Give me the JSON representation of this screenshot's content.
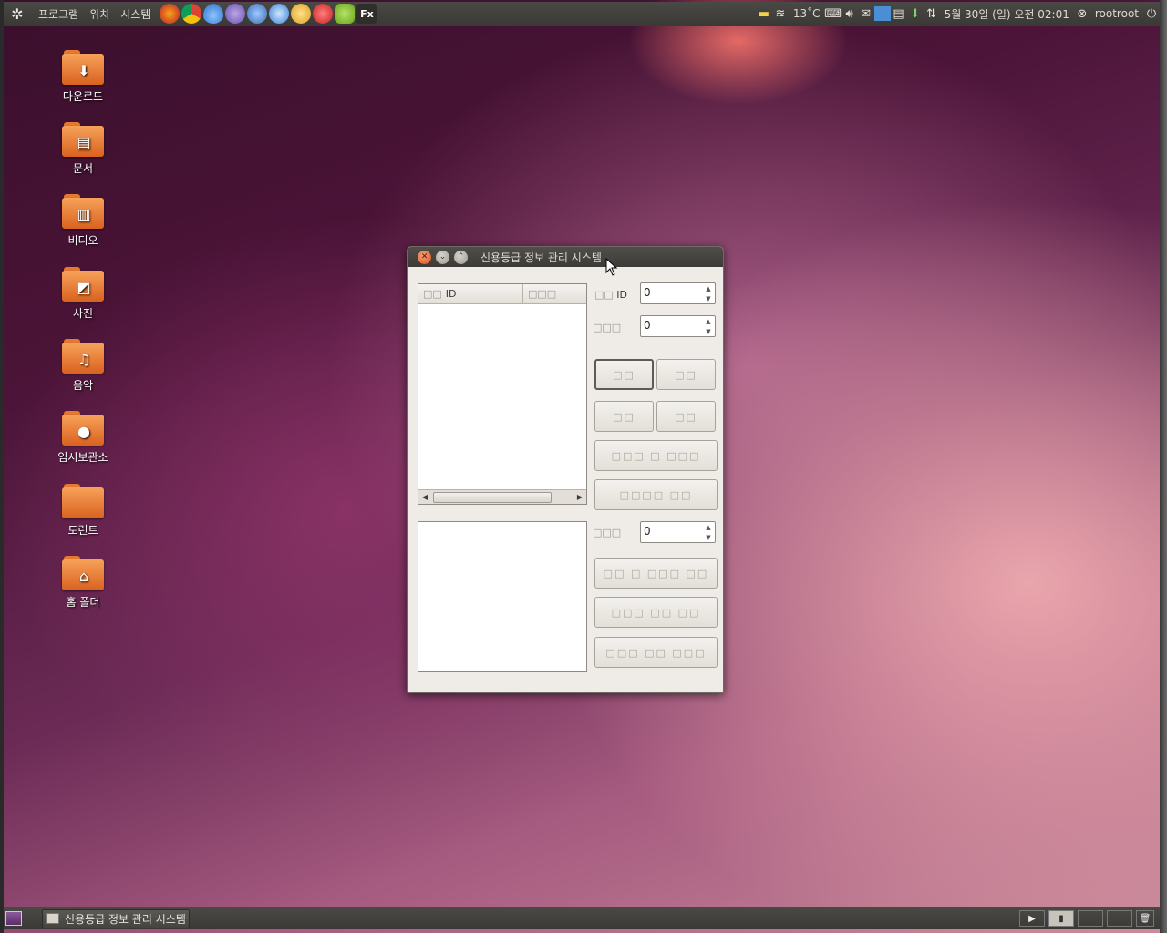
{
  "top_panel": {
    "menus": [
      "프로그램",
      "위치",
      "시스템"
    ],
    "launchers": [
      {
        "icon": "firefox-icon",
        "label": ""
      },
      {
        "icon": "chrome-icon",
        "label": ""
      },
      {
        "icon": "water-drop-icon",
        "label": ""
      },
      {
        "icon": "pidgin-icon",
        "label": ""
      },
      {
        "icon": "thunderbird-icon",
        "label": ""
      },
      {
        "icon": "blue-app-icon",
        "label": ""
      },
      {
        "icon": "cat-app-icon",
        "label": ""
      },
      {
        "icon": "red-app-icon",
        "label": ""
      },
      {
        "icon": "android-icon",
        "label": ""
      },
      {
        "icon": "fx-icon",
        "label": "Fx"
      }
    ],
    "weather": "13˚C",
    "datetime": "5월 30일 (일) 오전 02:01",
    "user": "rootroot"
  },
  "desktop_icons": [
    {
      "label": "다운로드",
      "emblem": "download-icon"
    },
    {
      "label": "문서",
      "emblem": "document-icon"
    },
    {
      "label": "비디오",
      "emblem": "film-icon"
    },
    {
      "label": "사진",
      "emblem": "photo-icon"
    },
    {
      "label": "음악",
      "emblem": "music-icon"
    },
    {
      "label": "임시보관소",
      "emblem": "person-icon"
    },
    {
      "label": "토런트",
      "emblem": ""
    },
    {
      "label": "홈 폴더",
      "emblem": "home-icon"
    }
  ],
  "window": {
    "title": "신용등급 정보 관리 시스템",
    "tree": {
      "col1_dim": "□□",
      "col1": "ID",
      "col2": "□□□"
    },
    "fields": {
      "id_label_dim": "□□",
      "id_label": "ID",
      "id_value": "0",
      "f2_label": "□□□",
      "f2_value": "0",
      "f3_label": "□□□",
      "f3_value": "0"
    },
    "buttons": {
      "b1": "□□",
      "b2": "□□",
      "b3": "□□",
      "b4": "□□",
      "b5": "□□□ □ □□□",
      "b6": "□□□□ □□",
      "b7": "□□ □ □□□ □□",
      "b8": "□□□ □□ □□",
      "b9": "□□□ □□ □□□"
    }
  },
  "bottom_panel": {
    "task": "신용등급 정보 관리 시스템"
  }
}
